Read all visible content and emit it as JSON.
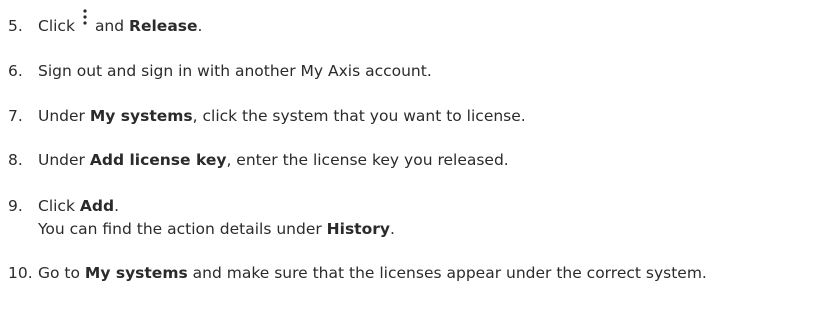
{
  "steps": [
    {
      "number": "5.",
      "p1": "Click",
      "icon": "more-vert-icon",
      "p2": "and",
      "b1": "Release",
      "p3": "."
    },
    {
      "number": "6.",
      "text": "Sign out and sign in with another My Axis account."
    },
    {
      "number": "7.",
      "p1": "Under",
      "b1": "My systems",
      "p2": ", click the system that you want to license."
    },
    {
      "number": "8.",
      "p1": "Under",
      "b1": "Add license key",
      "p2": ", enter the license key you released."
    },
    {
      "number": "9.",
      "p1": "Click",
      "b1": "Add",
      "p2": ".",
      "l2p1": "You can find the action details under",
      "l2b1": "History",
      "l2p2": "."
    },
    {
      "number": "10.",
      "p1": "Go to",
      "b1": "My systems",
      "p2": "and make sure that the licenses appear under the correct system."
    }
  ],
  "colors": {
    "text": "#2b2b2b",
    "background": "#ffffff"
  }
}
